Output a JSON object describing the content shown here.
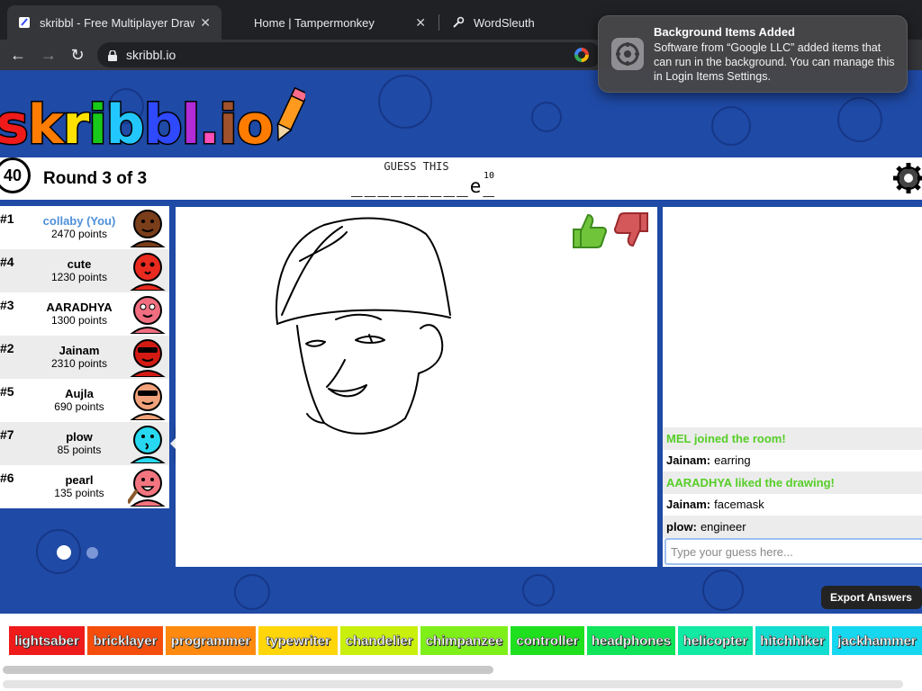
{
  "browser": {
    "tabs": [
      {
        "title": "skribbl - Free Multiplayer Draw",
        "close": "✕"
      },
      {
        "title": "Home | Tampermonkey",
        "close": "✕"
      },
      {
        "title": "WordSleuth"
      }
    ],
    "url": "skribbl.io"
  },
  "notification": {
    "title": "Background Items Added",
    "body": "Software from “Google LLC” added items that can run in the background. You can manage this in Login Items Settings."
  },
  "header": {
    "logo_letters": [
      "s",
      "k",
      "r",
      "i",
      "b",
      "b",
      "l",
      ".",
      "i",
      "o"
    ],
    "logo_colors": [
      "#ef1a1a",
      "#ff7c00",
      "#ffe100",
      "#19c919",
      "#23c7ff",
      "#2f49ff",
      "#b12bd6",
      "#ff4fb8",
      "#a0522d",
      "#ff7c00"
    ],
    "timer": "40",
    "round": "Round 3 of 3",
    "guess_label": "GUESS THIS",
    "word_hint": "_________e_",
    "word_length": "10"
  },
  "players": [
    {
      "rank": "#1",
      "name": "collaby (You)",
      "points": "2470 points",
      "me": true,
      "avatar_color": "#7b3e1a"
    },
    {
      "rank": "#4",
      "name": "cute",
      "points": "1230 points",
      "avatar_color": "#e82a1f"
    },
    {
      "rank": "#3",
      "name": "AARADHYA",
      "points": "1300 points",
      "avatar_color": "#f06e80"
    },
    {
      "rank": "#2",
      "name": "Jainam",
      "points": "2310 points",
      "avatar_color": "#d31b14"
    },
    {
      "rank": "#5",
      "name": "Aujla",
      "points": "690 points",
      "avatar_color": "#f1a27a"
    },
    {
      "rank": "#7",
      "name": "plow",
      "points": "85 points",
      "avatar_color": "#27d8f0"
    },
    {
      "rank": "#6",
      "name": "pearl",
      "points": "135 points",
      "avatar_color": "#f2757f"
    }
  ],
  "tooltip": "engineer",
  "chat": {
    "messages": [
      {
        "text": "MEL joined the room!",
        "system": true
      },
      {
        "who": "Jainam:",
        "text": "earring"
      },
      {
        "text": "AARADHYA liked the drawing!",
        "system": true
      },
      {
        "who": "Jainam:",
        "text": "facemask"
      },
      {
        "who": "plow:",
        "text": "engineer"
      }
    ],
    "input_placeholder": "Type your guess here..."
  },
  "export_label": "Export Answers",
  "words": [
    {
      "label": "lightsaber",
      "color": "#ef1a1a"
    },
    {
      "label": "bricklayer",
      "color": "#f54d0c"
    },
    {
      "label": "programmer",
      "color": "#ff8a0f"
    },
    {
      "label": "typewriter",
      "color": "#ffd60a"
    },
    {
      "label": "chandelier",
      "color": "#c9ef0d"
    },
    {
      "label": "chimpanzee",
      "color": "#7fef1a"
    },
    {
      "label": "controller",
      "color": "#1ee01e"
    },
    {
      "label": "headphones",
      "color": "#10e55a"
    },
    {
      "label": "helicopter",
      "color": "#12e9a3"
    },
    {
      "label": "hitchhiker",
      "color": "#12ddd0"
    },
    {
      "label": "jackhammer",
      "color": "#15d8f0"
    }
  ]
}
